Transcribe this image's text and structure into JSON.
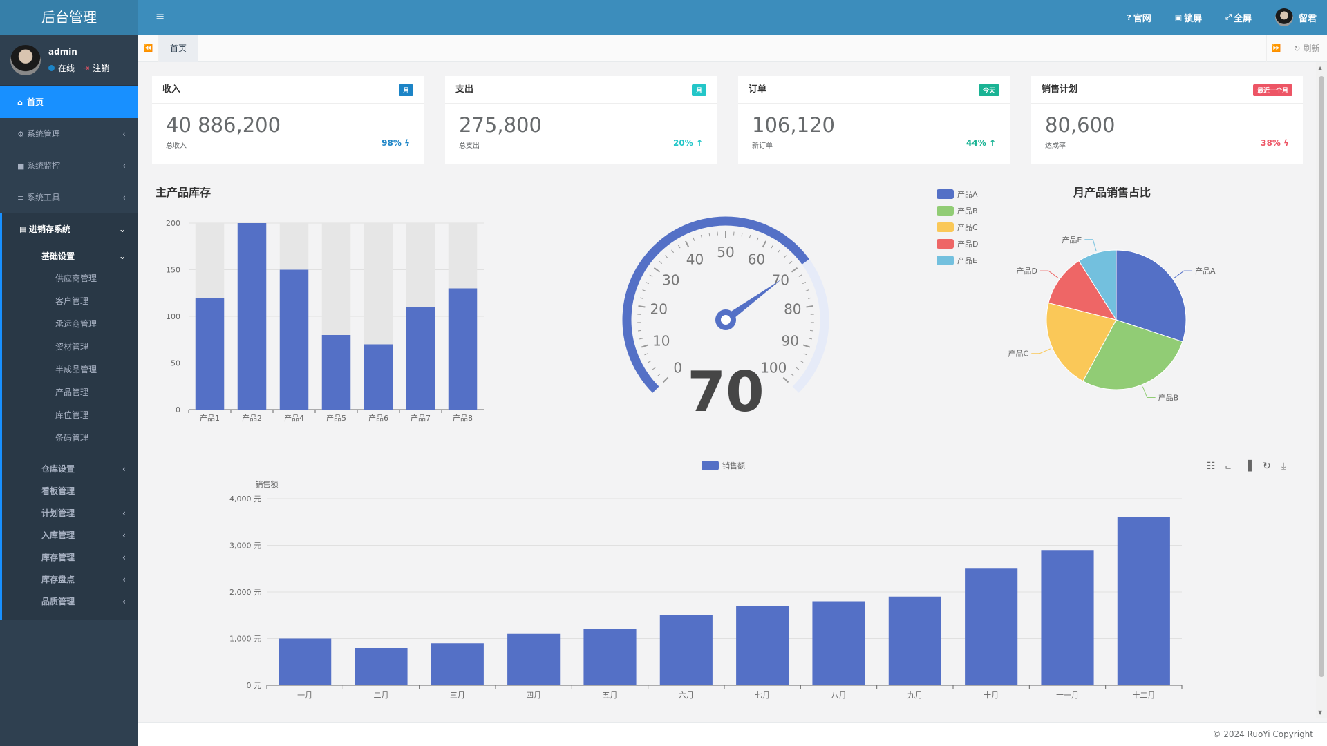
{
  "app": {
    "title": "后台管理"
  },
  "user": {
    "name": "admin",
    "status": "在线",
    "logout": "注销"
  },
  "menu": {
    "home": "首页",
    "items": [
      {
        "label": "系统管理",
        "icon": "gear-icon"
      },
      {
        "label": "系统监控",
        "icon": "video-icon"
      },
      {
        "label": "系统工具",
        "icon": "bars-icon"
      }
    ],
    "group": {
      "label": "进销存系统",
      "icon": "database-icon",
      "open_sub": "基础设置",
      "subsub": [
        "供应商管理",
        "客户管理",
        "承运商管理",
        "资材管理",
        "半成品管理",
        "产品管理",
        "库位管理",
        "条码管理"
      ],
      "subs": [
        {
          "label": "仓库设置",
          "arrow": true
        },
        {
          "label": "看板管理",
          "arrow": false
        },
        {
          "label": "计划管理",
          "arrow": true
        },
        {
          "label": "入库管理",
          "arrow": true
        },
        {
          "label": "库存管理",
          "arrow": true
        },
        {
          "label": "库存盘点",
          "arrow": true
        },
        {
          "label": "品质管理",
          "arrow": true
        }
      ]
    }
  },
  "topbar": {
    "website": "官网",
    "lock": "锁屏",
    "fullscreen": "全屏",
    "username": "留君"
  },
  "tabs": {
    "home": "首页",
    "refresh": "刷新"
  },
  "cards": [
    {
      "title": "收入",
      "badge": "月",
      "badge_color": "#1c84c6",
      "value": "40 886,200",
      "sub": "总收入",
      "pct": "98%",
      "pct_color": "#1c84c6",
      "trend": "bolt"
    },
    {
      "title": "支出",
      "badge": "月",
      "badge_color": "#23c6c8",
      "value": "275,800",
      "sub": "总支出",
      "pct": "20%",
      "pct_color": "#23c6c8",
      "trend": "up"
    },
    {
      "title": "订单",
      "badge": "今天",
      "badge_color": "#1ab394",
      "value": "106,120",
      "sub": "新订单",
      "pct": "44%",
      "pct_color": "#1ab394",
      "trend": "up"
    },
    {
      "title": "销售计划",
      "badge": "最近一个月",
      "badge_color": "#ed5565",
      "value": "80,600",
      "sub": "达成率",
      "pct": "38%",
      "pct_color": "#ed5565",
      "trend": "bolt"
    }
  ],
  "stock": {
    "title": "主产品库存",
    "chart_data": {
      "type": "bar",
      "categories": [
        "产品1",
        "产品2",
        "产品4",
        "产品5",
        "产品6",
        "产品7",
        "产品8"
      ],
      "values": [
        120,
        200,
        150,
        80,
        70,
        110,
        130
      ],
      "max": 200,
      "ylim": [
        0,
        200
      ],
      "yticks": [
        0,
        50,
        100,
        150,
        200
      ],
      "color": "#5470c6",
      "bg_color": "#e6e6e6"
    }
  },
  "gauge": {
    "value": 70,
    "min": 0,
    "max": 100,
    "labels": [
      "0",
      "10",
      "20",
      "30",
      "40",
      "50",
      "60",
      "70",
      "80",
      "90",
      "100"
    ],
    "color": "#5470c6",
    "track_color": "#e6ebf8"
  },
  "pie": {
    "title": "月产品销售占比",
    "chart_data": {
      "type": "pie",
      "slices": [
        {
          "name": "产品A",
          "value": 335,
          "color": "#5470c6"
        },
        {
          "name": "产品B",
          "value": 310,
          "color": "#91cc75"
        },
        {
          "name": "产品C",
          "value": 234,
          "color": "#fac858"
        },
        {
          "name": "产品D",
          "value": 135,
          "color": "#ee6666"
        },
        {
          "name": "产品E",
          "value": 100,
          "color": "#73c0de"
        }
      ],
      "legend": "top-left"
    }
  },
  "sales": {
    "legend": "销售额",
    "ylabel": "销售额",
    "chart_data": {
      "type": "bar",
      "categories": [
        "一月",
        "二月",
        "三月",
        "四月",
        "五月",
        "六月",
        "七月",
        "八月",
        "九月",
        "十月",
        "十一月",
        "十二月"
      ],
      "values": [
        1000,
        800,
        900,
        1100,
        1200,
        1500,
        1700,
        1800,
        1900,
        2500,
        2900,
        3600
      ],
      "ylim": [
        0,
        4000
      ],
      "yticks": [
        "0 元",
        "1,000 元",
        "2,000 元",
        "3,000 元",
        "4,000 元"
      ],
      "color": "#5470c6"
    }
  },
  "footer": {
    "copyright": "© 2024 RuoYi Copyright"
  }
}
